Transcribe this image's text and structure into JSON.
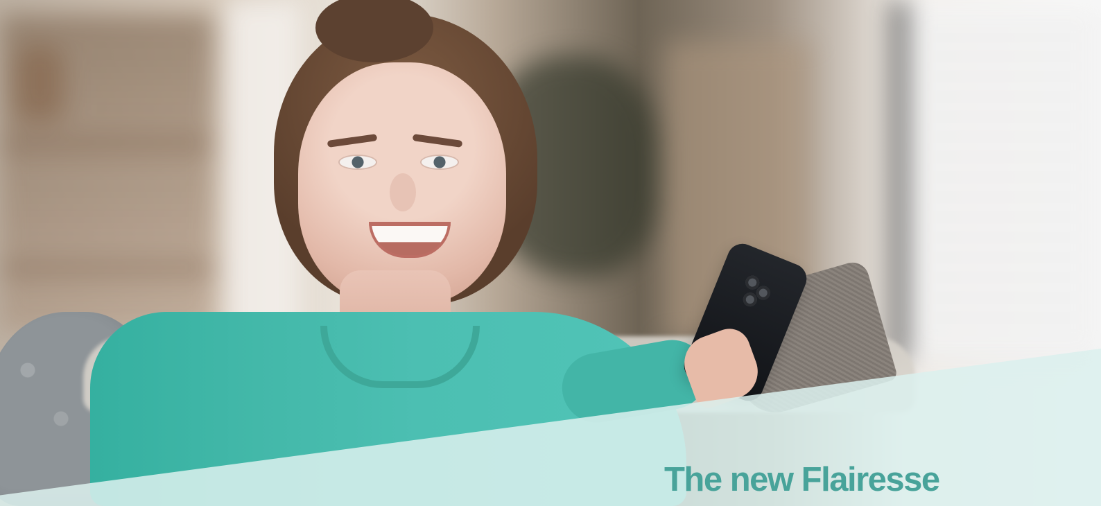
{
  "hero": {
    "headline_prefix": "The new",
    "brand_name": "Flairesse"
  },
  "colors": {
    "overlay": "#dbf0ee",
    "accent_text": "#48a39a",
    "sweater": "#44b8aa"
  },
  "icons": {
    "phone": "phone-icon"
  }
}
